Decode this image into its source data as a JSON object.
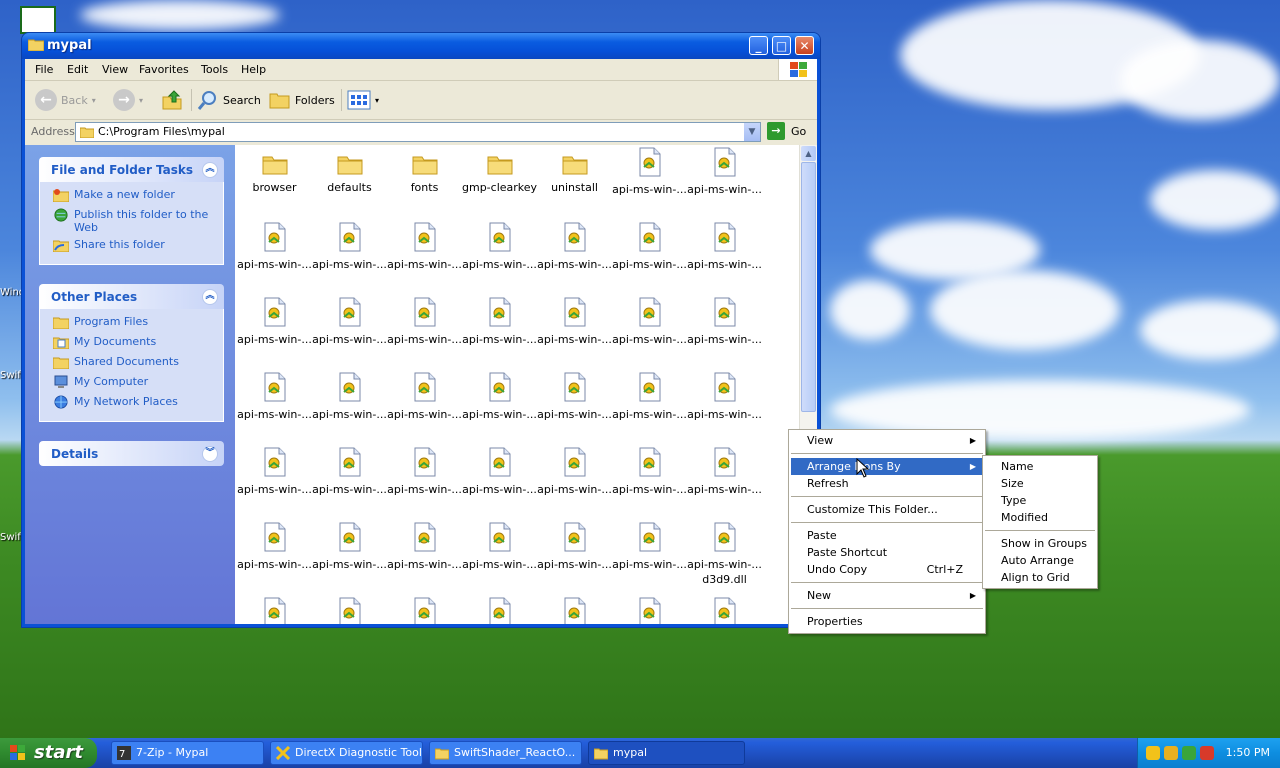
{
  "window": {
    "title": "mypal",
    "controls": [
      "_",
      "□",
      "✕"
    ]
  },
  "menubar": [
    "File",
    "Edit",
    "View",
    "Favorites",
    "Tools",
    "Help"
  ],
  "toolbar": {
    "back": "Back",
    "search": "Search",
    "folders": "Folders"
  },
  "address": {
    "label": "Address",
    "value": "C:\\Program Files\\mypal",
    "go": "Go"
  },
  "taskpane": {
    "file_tasks": {
      "title": "File and Folder Tasks",
      "items": [
        {
          "label": "Make a new folder",
          "icon": "new-folder-icon"
        },
        {
          "label": "Publish this folder to the Web",
          "icon": "publish-web-icon"
        },
        {
          "label": "Share this folder",
          "icon": "share-folder-icon"
        }
      ]
    },
    "other_places": {
      "title": "Other Places",
      "items": [
        {
          "label": "Program Files",
          "icon": "folder-icon"
        },
        {
          "label": "My Documents",
          "icon": "my-documents-icon"
        },
        {
          "label": "Shared Documents",
          "icon": "folder-icon"
        },
        {
          "label": "My Computer",
          "icon": "my-computer-icon"
        },
        {
          "label": "My Network Places",
          "icon": "network-places-icon"
        }
      ]
    },
    "details": {
      "title": "Details"
    }
  },
  "files": {
    "row1": [
      "browser",
      "defaults",
      "fonts",
      "gmp-clearkey",
      "uninstall",
      "api-ms-win-...",
      "api-ms-win-..."
    ],
    "dll_label": "api-ms-win-...",
    "d3d_label": "d3d9.dll"
  },
  "context_menu": {
    "items": {
      "view": "View",
      "arrange": "Arrange Icons By",
      "refresh": "Refresh",
      "customize": "Customize This Folder...",
      "paste": "Paste",
      "paste_shortcut": "Paste Shortcut",
      "undo_copy": "Undo Copy",
      "undo_shortcut": "Ctrl+Z",
      "new": "New",
      "properties": "Properties"
    }
  },
  "submenu": {
    "name": "Name",
    "size": "Size",
    "type": "Type",
    "modified": "Modified",
    "show_groups": "Show in Groups",
    "auto_arrange": "Auto Arrange",
    "align_grid": "Align to Grid"
  },
  "taskbar": {
    "start": "start",
    "buttons": [
      "7-Zip - Mypal",
      "DirectX Diagnostic Tool",
      "SwiftShader_ReactO...",
      "mypal"
    ],
    "clock": "1:50 PM"
  },
  "desktop_edge_labels": [
    "Wind",
    "Swif",
    "Swif"
  ],
  "colors": {
    "title_blue": "#0a5ce0",
    "selection_blue": "#316ac5",
    "taskpane_blue": "#7ba2e7",
    "start_green": "#2f8a2f"
  }
}
